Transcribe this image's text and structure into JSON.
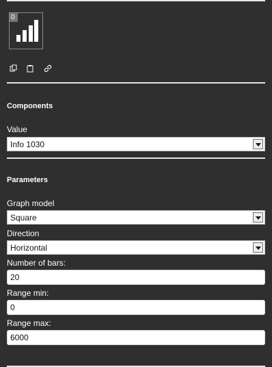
{
  "preview": {
    "value": "0",
    "icon": "bar-chart-icon"
  },
  "toolbar": {
    "icons": [
      "copy-icon",
      "clipboard-icon",
      "link-icon"
    ]
  },
  "components": {
    "title": "Components",
    "value_label": "Value",
    "value_selected": "Info 1030"
  },
  "parameters": {
    "title": "Parameters",
    "graph_model_label": "Graph model",
    "graph_model_selected": "Square",
    "direction_label": "Direction",
    "direction_selected": "Horizontal",
    "number_of_bars_label": "Number of bars:",
    "number_of_bars_value": "20",
    "range_min_label": "Range min:",
    "range_min_value": "0",
    "range_max_label": "Range max:",
    "range_max_value": "6000"
  },
  "colors": {
    "background": "#2f2f2f",
    "rule": "#e6e6e6",
    "field_bg": "#ffffff",
    "badge_bg": "#777777"
  }
}
